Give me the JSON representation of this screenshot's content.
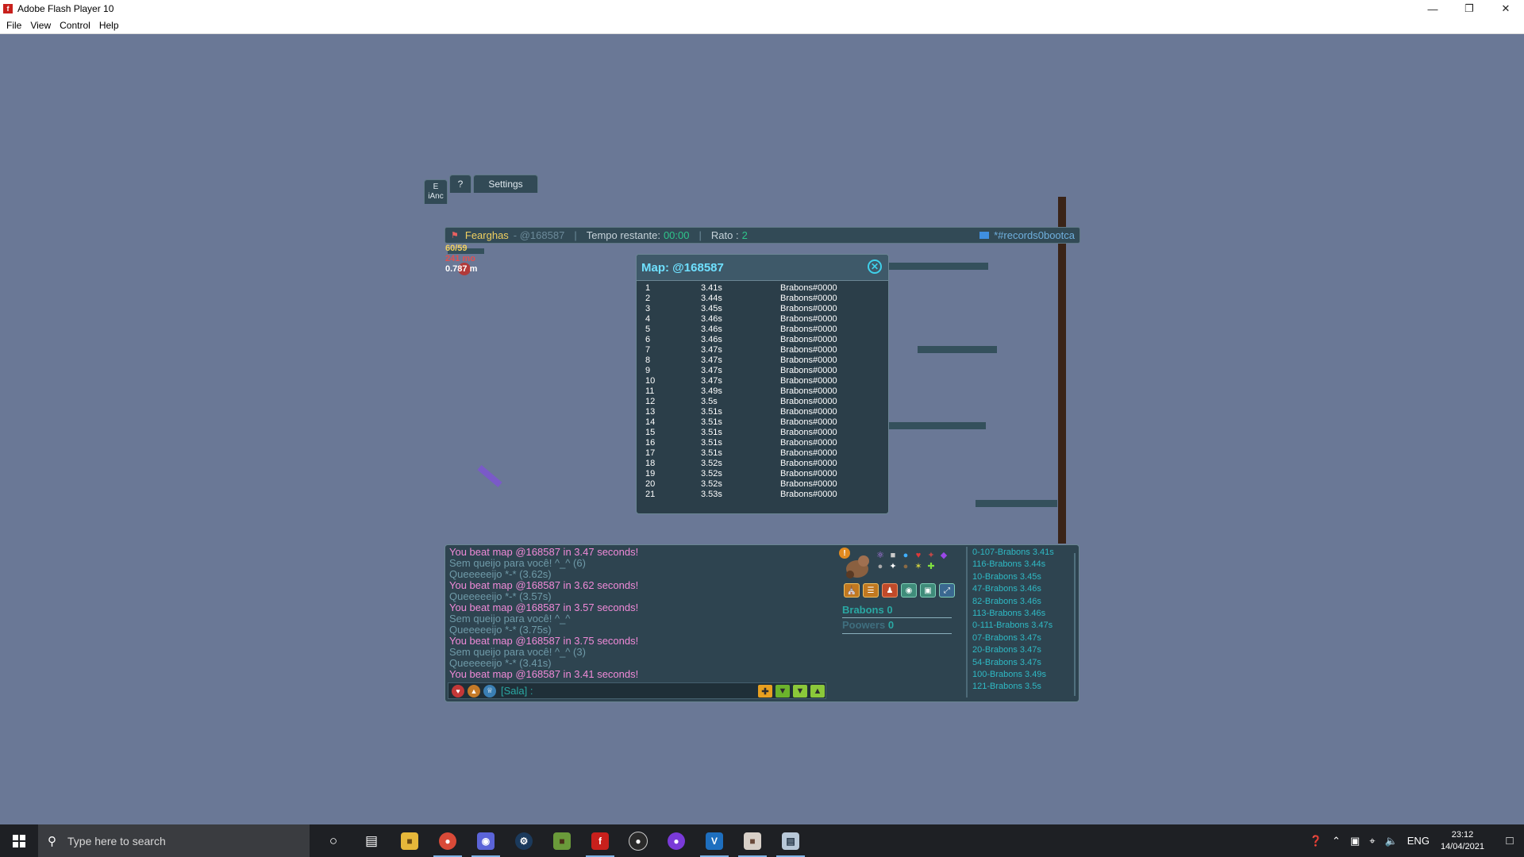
{
  "window": {
    "title": "Adobe Flash Player 10",
    "menu": [
      "File",
      "View",
      "Control",
      "Help"
    ],
    "controls": [
      "minimize",
      "restore",
      "close"
    ]
  },
  "tabs": {
    "help_label": "?",
    "settings_label": "Settings",
    "partial_left": "E",
    "partial_left2": "iAnc"
  },
  "infobar": {
    "nick": "Fearghas",
    "map_tag": "- @168587",
    "time_label": "Tempo restante:",
    "time_value": "00:00",
    "rato_label": "Rato :",
    "rato_value": "2",
    "room": "*#records0bootca"
  },
  "player_stats": {
    "line1": "60/59",
    "line2": "241 mo",
    "line3": "0.787 m"
  },
  "map_modal": {
    "title": "Map: @168587",
    "close_icon": "close-icon",
    "rows": [
      [
        "1",
        "3.41s",
        "Brabons#0000"
      ],
      [
        "2",
        "3.44s",
        "Brabons#0000"
      ],
      [
        "3",
        "3.45s",
        "Brabons#0000"
      ],
      [
        "4",
        "3.46s",
        "Brabons#0000"
      ],
      [
        "5",
        "3.46s",
        "Brabons#0000"
      ],
      [
        "6",
        "3.46s",
        "Brabons#0000"
      ],
      [
        "7",
        "3.47s",
        "Brabons#0000"
      ],
      [
        "8",
        "3.47s",
        "Brabons#0000"
      ],
      [
        "9",
        "3.47s",
        "Brabons#0000"
      ],
      [
        "10",
        "3.47s",
        "Brabons#0000"
      ],
      [
        "11",
        "3.49s",
        "Brabons#0000"
      ],
      [
        "12",
        "3.5s",
        "Brabons#0000"
      ],
      [
        "13",
        "3.51s",
        "Brabons#0000"
      ],
      [
        "14",
        "3.51s",
        "Brabons#0000"
      ],
      [
        "15",
        "3.51s",
        "Brabons#0000"
      ],
      [
        "16",
        "3.51s",
        "Brabons#0000"
      ],
      [
        "17",
        "3.51s",
        "Brabons#0000"
      ],
      [
        "18",
        "3.52s",
        "Brabons#0000"
      ],
      [
        "19",
        "3.52s",
        "Brabons#0000"
      ],
      [
        "20",
        "3.52s",
        "Brabons#0000"
      ],
      [
        "21",
        "3.53s",
        "Brabons#0000"
      ]
    ]
  },
  "chat": {
    "lines": [
      {
        "text": "You beat map @168587 in 3.47 seconds!",
        "style": "pink"
      },
      {
        "text": "Sem queijo para você! ^_^ (6)",
        "style": "muted"
      },
      {
        "text": "Queeeeeijo *-* (3.62s)",
        "style": "muted"
      },
      {
        "text": "You beat map @168587 in 3.62 seconds!",
        "style": "pink"
      },
      {
        "text": "Queeeeeijo *-* (3.57s)",
        "style": "muted"
      },
      {
        "text": "You beat map @168587 in 3.57 seconds!",
        "style": "pink"
      },
      {
        "text": "Sem queijo para você! ^_^",
        "style": "muted"
      },
      {
        "text": "Queeeeeijo *-* (3.75s)",
        "style": "muted"
      },
      {
        "text": "You beat map @168587 in 3.75 seconds!",
        "style": "pink"
      },
      {
        "text": "Sem queijo para você! ^_^ (3)",
        "style": "muted"
      },
      {
        "text": "Queeeeeijo *-* (3.41s)",
        "style": "muted"
      },
      {
        "text": "You beat map @168587 in 3.41 seconds!",
        "style": "pink"
      }
    ],
    "channel": "[Sala] :",
    "input_value": ""
  },
  "player_panel": {
    "name": "Brabons",
    "name_score": "0",
    "powers_label": "Poowers",
    "powers_score": "0"
  },
  "ranking": [
    "0-107-Brabons 3.41s",
    "116-Brabons 3.44s",
    "10-Brabons 3.45s",
    "47-Brabons 3.46s",
    "82-Brabons 3.46s",
    "113-Brabons 3.46s",
    "0-111-Brabons 3.47s",
    "07-Brabons 3.47s",
    "20-Brabons 3.47s",
    "54-Brabons 3.47s",
    "100-Brabons 3.49s",
    "121-Brabons 3.5s"
  ],
  "taskbar": {
    "search_placeholder": "Type here to search",
    "language": "ENG",
    "time": "23:12",
    "date": "14/04/2021"
  },
  "colors": {
    "background": "#6a7896",
    "panel": "#2e4450",
    "pink": "#f08ad8",
    "teal": "#2aa8a3"
  }
}
